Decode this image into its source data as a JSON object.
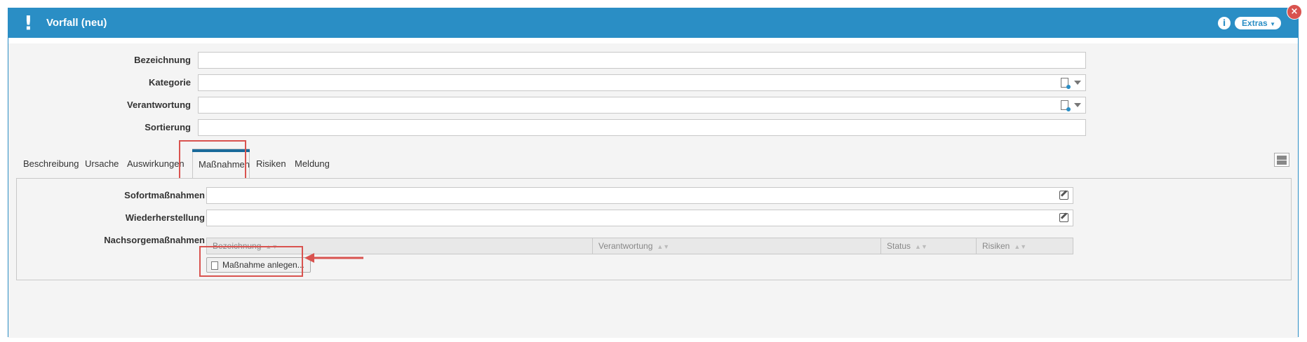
{
  "window": {
    "title": "Vorfall (neu)"
  },
  "toolbar": {
    "info_icon": "i",
    "help_icon": "?",
    "extras_label": "Extras"
  },
  "form": {
    "fields": [
      {
        "label": "Bezeichnung",
        "value": ""
      },
      {
        "label": "Kategorie",
        "value": ""
      },
      {
        "label": "Verantwortung",
        "value": ""
      },
      {
        "label": "Sortierung",
        "value": ""
      }
    ]
  },
  "tabs": [
    {
      "label": "Beschreibung"
    },
    {
      "label": "Ursache"
    },
    {
      "label": "Auswirkungen"
    },
    {
      "label": "Maßnahmen",
      "active": true
    },
    {
      "label": "Risiken"
    },
    {
      "label": "Meldung"
    }
  ],
  "panel": {
    "sofortmassnahmen_label": "Sofortmaßnahmen",
    "sofortmassnahmen_value": "",
    "wiederherstellung_label": "Wiederherstellung",
    "wiederherstellung_value": "",
    "nachsorge_label": "Nachsorgemaßnahmen",
    "grid_columns": [
      "Bezeichnung",
      "Verantwortung",
      "Status",
      "Risiken"
    ],
    "add_button_label": "Maßnahme anlegen..."
  },
  "colors": {
    "header_blue": "#2a8ec5",
    "highlight_red": "#d9534f"
  }
}
